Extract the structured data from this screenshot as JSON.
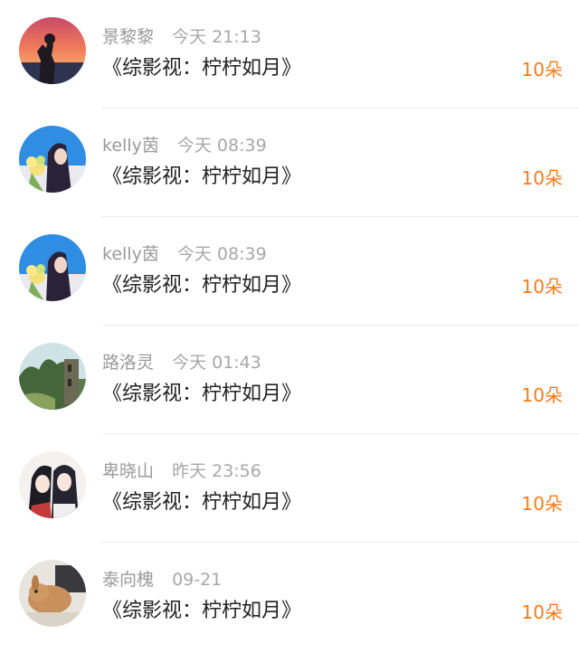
{
  "colors": {
    "accent": "#ff7a1a",
    "name_text": "#9a9a9a",
    "title_text": "#222222",
    "divider": "#ececec"
  },
  "rows": [
    {
      "avatar": "sunset-silhouette-avatar",
      "name": "景黎黎",
      "time": "今天 21:13",
      "title": "《综影视：柠柠如月》",
      "gift": "10朵"
    },
    {
      "avatar": "girl-with-flowers-avatar",
      "name": "kelly茵",
      "time": "今天 08:39",
      "title": "《综影视：柠柠如月》",
      "gift": "10朵"
    },
    {
      "avatar": "girl-with-flowers-avatar",
      "name": "kelly茵",
      "time": "今天 08:39",
      "title": "《综影视：柠柠如月》",
      "gift": "10朵"
    },
    {
      "avatar": "forest-ruins-avatar",
      "name": "路洛灵",
      "time": "今天 01:43",
      "title": "《综影视：柠柠如月》",
      "gift": "10朵"
    },
    {
      "avatar": "anime-couple-avatar",
      "name": "卑晓山",
      "time": "昨天 23:56",
      "title": "《综影视：柠柠如月》",
      "gift": "10朵"
    },
    {
      "avatar": "rabbit-avatar",
      "name": "泰向槐",
      "time": "09-21",
      "title": "《综影视：柠柠如月》",
      "gift": "10朵"
    }
  ]
}
